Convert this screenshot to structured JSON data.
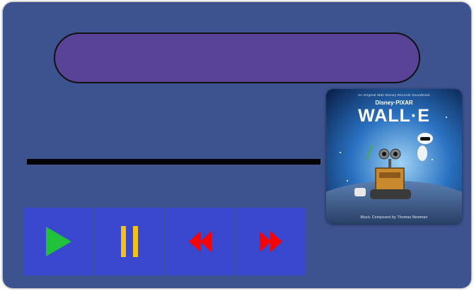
{
  "player": {
    "now_playing_title": "",
    "progress": 0,
    "colors": {
      "frame": "#3d5390",
      "title_display": "#584396",
      "control_button": "#3a47cf",
      "play_icon": "#1fc23a",
      "pause_icon": "#f2c21b",
      "seek_icons": "#ff0000"
    }
  },
  "controls": [
    {
      "name": "play",
      "icon": "play-icon"
    },
    {
      "name": "pause",
      "icon": "pause-icon"
    },
    {
      "name": "rewind",
      "icon": "rewind-icon"
    },
    {
      "name": "fast-forward",
      "icon": "fast-forward-icon"
    }
  ],
  "album": {
    "subtitle": "An Original Walt Disney Records Soundtrack",
    "studio": "Disney·PIXAR",
    "title": "WALL·E",
    "credit": "Music Composed by Thomas Newman"
  }
}
